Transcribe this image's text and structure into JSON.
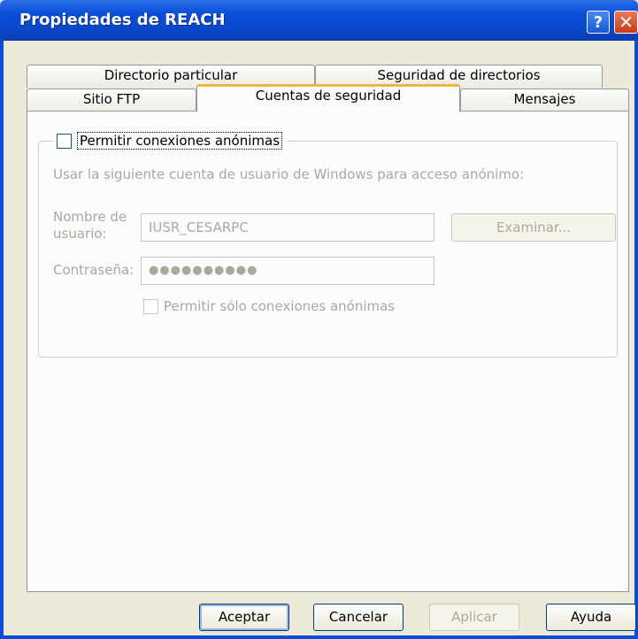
{
  "window": {
    "title": "Propiedades de REACH",
    "help_glyph": "?",
    "close_glyph": "✕"
  },
  "tabs_row1": [
    {
      "label": "Directorio particular"
    },
    {
      "label": "Seguridad de directorios"
    }
  ],
  "tabs_row2": [
    {
      "label": "Sitio FTP"
    },
    {
      "label": "Cuentas de seguridad",
      "active": true
    },
    {
      "label": "Mensajes"
    }
  ],
  "group": {
    "checkbox_label": "Permitir conexiones anónimas",
    "checked": false,
    "description": "Usar la siguiente cuenta de usuario de Windows para acceso anónimo:",
    "username_label_line1": "Nombre de",
    "username_label_line2": "usuario:",
    "username_value": "IUSR_CESARPC",
    "browse_label": "Examinar...",
    "password_label": "Contraseña:",
    "password_value": "●●●●●●●●●●",
    "only_anon_label": "Permitir sólo conexiones anónimas",
    "only_anon_checked": false
  },
  "buttons": {
    "ok": "Aceptar",
    "cancel": "Cancelar",
    "apply": "Aplicar",
    "help": "Ayuda"
  },
  "colors": {
    "titlebar": "#0a4cd8",
    "active_tab_accent": "#f2b43a",
    "disabled_text": "#aca899"
  }
}
